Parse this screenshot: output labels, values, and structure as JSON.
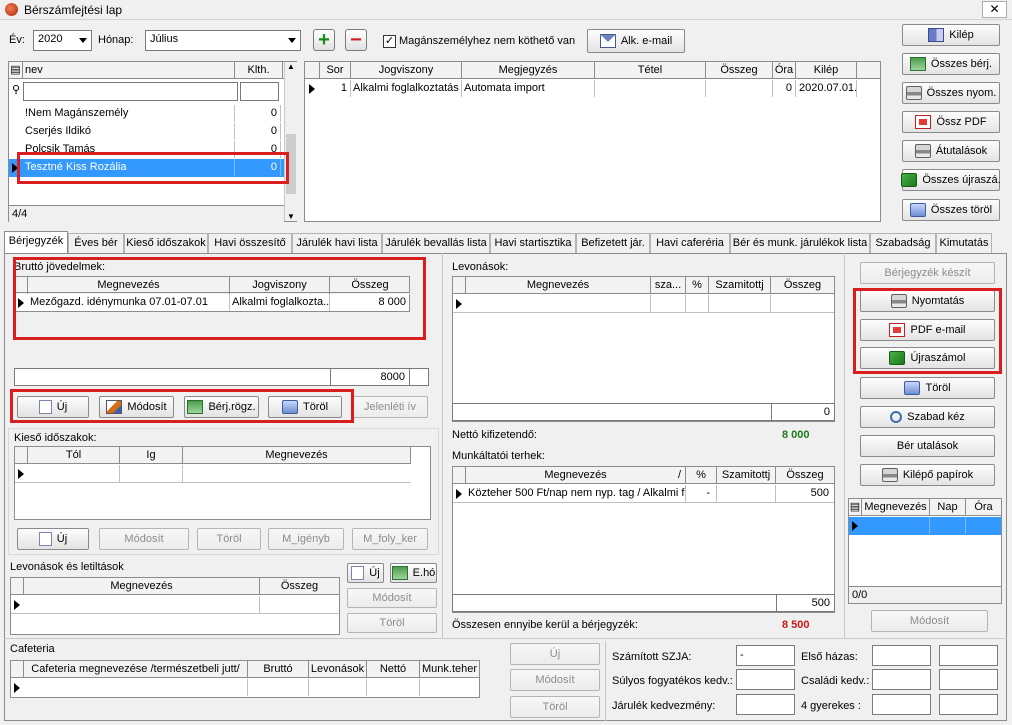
{
  "window": {
    "title": "Bérszámfejtési lap",
    "close": "✕"
  },
  "filters": {
    "year_label": "Év:",
    "year": "2020",
    "month_label": "Hónap:",
    "month": "Július",
    "checkbox_label": "Magánszemélyhez nem köthető van",
    "email_button": "Alk. e-mail"
  },
  "person_list": {
    "col_name": "nev",
    "col_klth": "Klth.",
    "rows": [
      {
        "name": "!Nem Magánszemély",
        "klth": "0"
      },
      {
        "name": "Cserjés Ildikó",
        "klth": "0"
      },
      {
        "name": "Polcsik Tamás",
        "klth": "0"
      },
      {
        "name": "Tesztné Kiss Rozália",
        "klth": "0"
      }
    ],
    "counter": "4/4"
  },
  "contract_grid": {
    "cols": [
      "Sor",
      "Jogviszony",
      "Megjegyzés",
      "Tétel",
      "Összeg",
      "Óra",
      "Kilép"
    ],
    "row": {
      "sor": "1",
      "jogviszony": "Alkalmi foglalkoztatás",
      "megjegyzes": "Automata import",
      "tetel": "",
      "osszeg": "",
      "ora": "0",
      "kilep": "2020.07.01."
    }
  },
  "right_buttons": [
    "Kilép",
    "Összes bérj.",
    "Összes nyom.",
    "Össz PDF",
    "Átutalások",
    "Összes újraszá.",
    "Összes töröl"
  ],
  "tabs": [
    "Bérjegyzék",
    "Éves bér",
    "Kieső időszakok",
    "Havi összesítő",
    "Járulék havi lista",
    "Járulék bevallás lista",
    "Havi startisztika",
    "Befizetett jár.",
    "Havi caferéria",
    "Bér és munk. járulékok lista",
    "Szabadság",
    "Kimutatás"
  ],
  "gross": {
    "title": "Bruttó jövedelmek:",
    "cols": [
      "Megnevezés",
      "Jogviszony",
      "Összeg"
    ],
    "row": {
      "megnevezes": "Mezőgazd. idénymunka 07.01-07.01",
      "jogviszony": "Alkalmi foglalkozta...",
      "osszeg": "8 000"
    },
    "total": "8000",
    "buttons": {
      "uj": "Új",
      "modosit": "Módosít",
      "berj": "Bérj.rögz.",
      "torol": "Töröl",
      "jelenleti": "Jelenléti ív"
    }
  },
  "absence": {
    "title": "Kieső időszakok:",
    "cols": [
      "Tól",
      "Ig",
      "Megnevezés"
    ],
    "buttons": {
      "uj": "Új",
      "modosit": "Módosít",
      "torol": "Töröl",
      "m_igenyb": "M_igényb",
      "m_foly": "M_foly_ker"
    }
  },
  "deductions_left": {
    "title": "Levonások és letiltások",
    "cols": [
      "Megnevezés",
      "Összeg"
    ],
    "buttons": {
      "uj": "Új",
      "eho": "E.hó",
      "modosit": "Módosít",
      "torol": "Töröl"
    }
  },
  "cafeteria": {
    "title": "Cafeteria",
    "cols": [
      "Cafeteria megnevezése /természetbeli jutt/",
      "Bruttó",
      "Levonások",
      "Nettó",
      "Munk.teher"
    ],
    "buttons": {
      "uj": "Új",
      "modosit": "Módosít",
      "torol": "Töröl"
    }
  },
  "deductions": {
    "title": "Levonások:",
    "cols": [
      "Megnevezés",
      "sza...",
      "%",
      "Szamitottj",
      "Összeg"
    ],
    "total": "0"
  },
  "net": {
    "label": "Nettó kifizetendő:",
    "value": "8 000"
  },
  "employer": {
    "title": "Munkáltatói terhek:",
    "cols": [
      "Megnevezés",
      "/",
      "%",
      "Szamitottj",
      "Összeg"
    ],
    "row": {
      "megnevezes": "Közteher 500 Ft/nap nem nyp. tag / Alkalmi fo",
      "pct": "-",
      "szamitott": "",
      "osszeg": "500"
    },
    "total": "500"
  },
  "payslip_total": {
    "label": "Összesen ennyibe kerül a bérjegyzék:",
    "value": "8 500"
  },
  "payslip_buttons": {
    "keszit": "Bérjegyzék készít",
    "nyomtatas": "Nyomtatás",
    "pdf": "PDF e-mail",
    "ujraszamol": "Újraszámol",
    "torol": "Töröl",
    "szabad": "Szabad kéz",
    "berut": "Bér utalások",
    "kilepo": "Kilépő papírok",
    "modosit": "Módosít"
  },
  "vacation": {
    "cols": [
      "Megnevezés",
      "Nap",
      "Óra"
    ],
    "counter": "0/0"
  },
  "tax_fields": {
    "szja": "Számított SZJA:",
    "szja_val": "-",
    "elso": "Első házas:",
    "sulyos": "Súlyos fogyatékos kedv.:",
    "csaladi": "Családi kedv.:",
    "jarulek": "Járulék kedvezmény:",
    "gyerekes": "4 gyerekes :"
  },
  "colors": {
    "selection": "#3399ff",
    "highlight_box": "#d81e1e",
    "net_green": "#1a7a1a",
    "total_red": "#c81818"
  }
}
